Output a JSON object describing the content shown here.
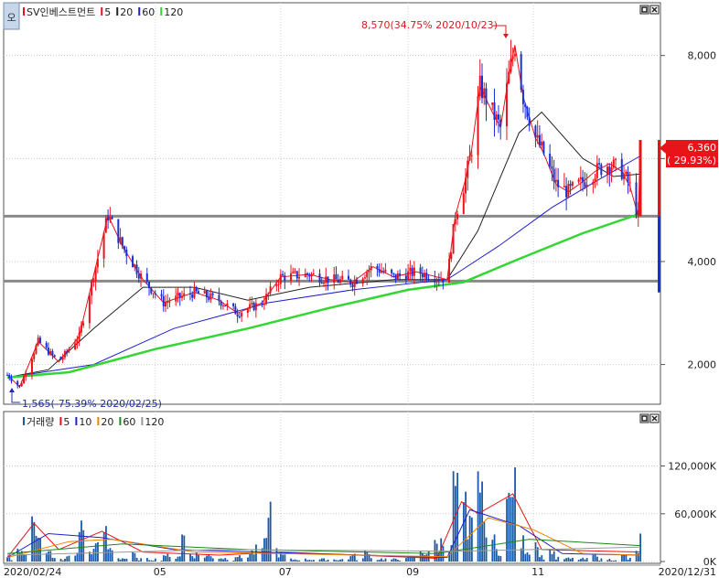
{
  "price_panel": {
    "logo_label": "오",
    "legend": [
      {
        "label": "SV인베스트먼트",
        "color": "#e8141a"
      },
      {
        "label": "5",
        "color": "#e8141a"
      },
      {
        "label": "20",
        "color": "#222222"
      },
      {
        "label": "60",
        "color": "#2020d0"
      },
      {
        "label": "120",
        "color": "#33d633"
      }
    ],
    "high_annotation": "8,570(34.75% 2020/10/23)",
    "low_annotation": "1,565(-75.39% 2020/02/25)",
    "price_tag_value": "6,360",
    "price_tag_change": "( 29.93%)",
    "horizontal_lines": [
      4880,
      3620
    ]
  },
  "volume_panel": {
    "legend": [
      {
        "label": "거래량",
        "color": "#1a5aa8"
      },
      {
        "label": "5",
        "color": "#e8141a"
      },
      {
        "label": "10",
        "color": "#2020d0"
      },
      {
        "label": "20",
        "color": "#f08000"
      },
      {
        "label": "60",
        "color": "#1a8a1a"
      },
      {
        "label": "120",
        "color": "#999999"
      }
    ]
  },
  "x_axis_labels": [
    "2020/02/24",
    "05",
    "07",
    "09",
    "11",
    "2020/12/31"
  ],
  "chart_data": [
    {
      "type": "candlestick",
      "title": "SV인베스트먼트",
      "x_range": [
        "2020/02/24",
        "2020/12/31"
      ],
      "ylim": [
        1300,
        8900
      ],
      "y_ticks": [
        "2,000",
        "4,000",
        "6,000",
        "8,000"
      ],
      "y_tick_values": [
        2000,
        4000,
        6000,
        8000
      ],
      "series_points": [
        [
          "2020-02-19",
          1800
        ],
        [
          "2020-02-25",
          1565
        ],
        [
          "2020-03-05",
          2450
        ],
        [
          "2020-03-15",
          2050
        ],
        [
          "2020-03-25",
          2550
        ],
        [
          "2020-04-02",
          3900
        ],
        [
          "2020-04-08",
          4900
        ],
        [
          "2020-04-15",
          4300
        ],
        [
          "2020-04-25",
          3650
        ],
        [
          "2020-05-05",
          3200
        ],
        [
          "2020-05-20",
          3400
        ],
        [
          "2020-06-01",
          3250
        ],
        [
          "2020-06-10",
          3000
        ],
        [
          "2020-06-22",
          3200
        ],
        [
          "2020-07-01",
          3700
        ],
        [
          "2020-07-15",
          3750
        ],
        [
          "2020-07-25",
          3650
        ],
        [
          "2020-08-05",
          3600
        ],
        [
          "2020-08-15",
          3900
        ],
        [
          "2020-08-25",
          3700
        ],
        [
          "2020-09-05",
          3800
        ],
        [
          "2020-09-15",
          3700
        ],
        [
          "2020-09-20",
          3650
        ],
        [
          "2020-09-24",
          4900
        ],
        [
          "2020-09-29",
          5600
        ],
        [
          "2020-10-02",
          6200
        ],
        [
          "2020-10-06",
          7400
        ],
        [
          "2020-10-12",
          6900
        ],
        [
          "2020-10-16",
          6600
        ],
        [
          "2020-10-20",
          7600
        ],
        [
          "2020-10-23",
          8200
        ],
        [
          "2020-10-27",
          7200
        ],
        [
          "2020-11-02",
          6400
        ],
        [
          "2020-11-06",
          6100
        ],
        [
          "2020-11-12",
          5500
        ],
        [
          "2020-11-18",
          5350
        ],
        [
          "2020-11-25",
          5550
        ],
        [
          "2020-12-01",
          5750
        ],
        [
          "2020-12-08",
          5900
        ],
        [
          "2020-12-14",
          5750
        ],
        [
          "2020-12-18",
          5450
        ],
        [
          "2020-12-22",
          4880
        ],
        [
          "2020-12-23",
          6360
        ]
      ],
      "moving_averages": {
        "ma20": [
          [
            "2020-02-19",
            1750
          ],
          [
            "2020-03-10",
            1900
          ],
          [
            "2020-04-01",
            2700
          ],
          [
            "2020-04-25",
            3500
          ],
          [
            "2020-05-20",
            3500
          ],
          [
            "2020-06-15",
            3250
          ],
          [
            "2020-07-15",
            3500
          ],
          [
            "2020-08-25",
            3650
          ],
          [
            "2020-09-20",
            3650
          ],
          [
            "2020-10-05",
            4600
          ],
          [
            "2020-10-25",
            6500
          ],
          [
            "2020-11-05",
            6900
          ],
          [
            "2020-11-25",
            6000
          ],
          [
            "2020-12-10",
            5650
          ],
          [
            "2020-12-23",
            5700
          ]
        ],
        "ma60": [
          [
            "2020-02-19",
            1750
          ],
          [
            "2020-04-01",
            2000
          ],
          [
            "2020-05-10",
            2700
          ],
          [
            "2020-06-25",
            3200
          ],
          [
            "2020-08-05",
            3450
          ],
          [
            "2020-09-20",
            3650
          ],
          [
            "2020-10-15",
            4300
          ],
          [
            "2020-11-10",
            5050
          ],
          [
            "2020-12-01",
            5550
          ],
          [
            "2020-12-23",
            6050
          ]
        ],
        "ma120": [
          [
            "2020-02-19",
            1750
          ],
          [
            "2020-03-20",
            1850
          ],
          [
            "2020-05-01",
            2300
          ],
          [
            "2020-06-15",
            2700
          ],
          [
            "2020-07-25",
            3100
          ],
          [
            "2020-09-01",
            3450
          ],
          [
            "2020-09-28",
            3600
          ],
          [
            "2020-10-25",
            4050
          ],
          [
            "2020-11-25",
            4550
          ],
          [
            "2020-12-23",
            4930
          ]
        ]
      }
    },
    {
      "type": "bar",
      "title": "거래량",
      "ylim": [
        0,
        170000
      ],
      "y_ticks": [
        "120,000K",
        "60,000K",
        "0K"
      ],
      "y_tick_values": [
        120000,
        60000,
        0
      ],
      "volume_points": [
        [
          "2020-02-19",
          6000
        ],
        [
          "2020-02-25",
          18000
        ],
        [
          "2020-03-02",
          60000
        ],
        [
          "2020-03-05",
          45000
        ],
        [
          "2020-03-10",
          15000
        ],
        [
          "2020-03-20",
          8000
        ],
        [
          "2020-03-26",
          55000
        ],
        [
          "2020-04-02",
          25000
        ],
        [
          "2020-04-06",
          48000
        ],
        [
          "2020-04-09",
          20000
        ],
        [
          "2020-04-20",
          12000
        ],
        [
          "2020-05-06",
          10000
        ],
        [
          "2020-05-15",
          40000
        ],
        [
          "2020-06-10",
          8000
        ],
        [
          "2020-06-26",
          85000
        ],
        [
          "2020-07-03",
          10000
        ],
        [
          "2020-08-05",
          10000
        ],
        [
          "2020-08-12",
          15000
        ],
        [
          "2020-09-01",
          7000
        ],
        [
          "2020-09-24",
          120000
        ],
        [
          "2020-09-28",
          90000
        ],
        [
          "2020-10-02",
          60000
        ],
        [
          "2020-10-06",
          125000
        ],
        [
          "2020-10-08",
          50000
        ],
        [
          "2020-10-12",
          35000
        ],
        [
          "2020-10-20",
          95000
        ],
        [
          "2020-10-23",
          120000
        ],
        [
          "2020-11-02",
          30000
        ],
        [
          "2020-11-10",
          15000
        ],
        [
          "2020-12-01",
          10000
        ],
        [
          "2020-12-15",
          10000
        ],
        [
          "2020-12-22",
          15000
        ],
        [
          "2020-12-23",
          38000
        ]
      ],
      "moving_averages": {
        "ma5": [
          [
            "2020-02-19",
            5000
          ],
          [
            "2020-03-03",
            48000
          ],
          [
            "2020-03-15",
            15000
          ],
          [
            "2020-04-05",
            38000
          ],
          [
            "2020-04-25",
            12000
          ],
          [
            "2020-06-01",
            8000
          ],
          [
            "2020-07-01",
            12000
          ],
          [
            "2020-09-15",
            4000
          ],
          [
            "2020-09-27",
            75000
          ],
          [
            "2020-10-05",
            60000
          ],
          [
            "2020-10-22",
            85000
          ],
          [
            "2020-11-05",
            15000
          ],
          [
            "2020-12-23",
            12000
          ]
        ],
        "ma10": [
          [
            "2020-02-19",
            5000
          ],
          [
            "2020-03-10",
            35000
          ],
          [
            "2020-04-05",
            30000
          ],
          [
            "2020-05-10",
            15000
          ],
          [
            "2020-09-20",
            5000
          ],
          [
            "2020-10-01",
            65000
          ],
          [
            "2020-10-25",
            45000
          ],
          [
            "2020-11-15",
            10000
          ],
          [
            "2020-12-23",
            8000
          ]
        ],
        "ma20": [
          [
            "2020-02-19",
            5000
          ],
          [
            "2020-03-20",
            25000
          ],
          [
            "2020-04-10",
            28000
          ],
          [
            "2020-05-20",
            12000
          ],
          [
            "2020-09-20",
            6000
          ],
          [
            "2020-10-10",
            55000
          ],
          [
            "2020-11-01",
            40000
          ],
          [
            "2020-11-25",
            10000
          ],
          [
            "2020-12-23",
            8000
          ]
        ],
        "ma60": [
          [
            "2020-02-19",
            10000
          ],
          [
            "2020-04-15",
            22000
          ],
          [
            "2020-06-15",
            15000
          ],
          [
            "2020-09-15",
            10000
          ],
          [
            "2020-10-30",
            28000
          ],
          [
            "2020-12-23",
            20000
          ]
        ],
        "ma120": [
          [
            "2020-02-19",
            8000
          ],
          [
            "2020-06-01",
            15000
          ],
          [
            "2020-09-25",
            13000
          ],
          [
            "2020-12-23",
            18000
          ]
        ]
      }
    }
  ]
}
